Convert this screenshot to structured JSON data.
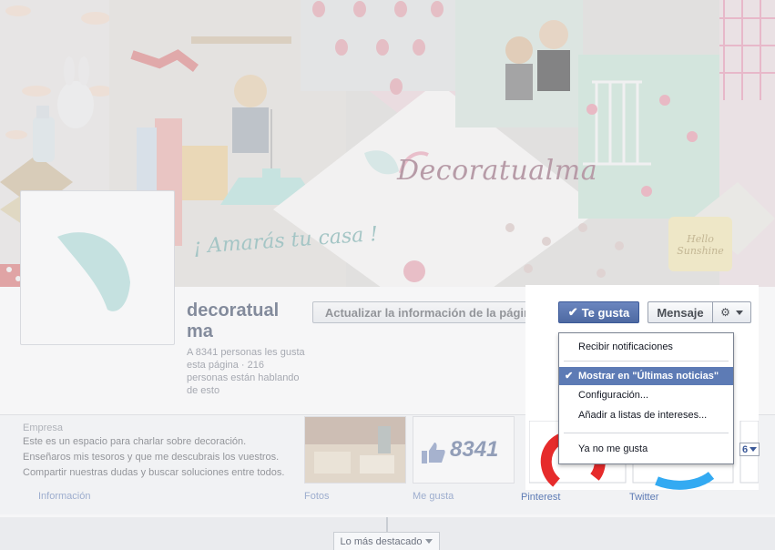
{
  "cover": {
    "brand_text": "Decoratualma",
    "tagline": "¡ Amarás tu casa !",
    "sign_text": "Hello Sunshine"
  },
  "page": {
    "name_line1": "decoratual",
    "name_line2": "ma",
    "stats": "A 8341 personas les gusta esta página · 216 personas están hablando de esto"
  },
  "actions": {
    "update_label": "Actualizar la información de la página",
    "like_label": "Te gusta",
    "message_label": "Mensaje"
  },
  "dropdown": {
    "items": [
      {
        "label": "Recibir notificaciones",
        "checked": false
      },
      {
        "label": "Mostrar en \"Últimas noticias\"",
        "checked": true
      },
      {
        "label": "Configuración...",
        "checked": false
      },
      {
        "label": "Añadir a listas de intereses...",
        "checked": false
      },
      {
        "label": "Ya no me gusta",
        "checked": false
      }
    ]
  },
  "about": {
    "category": "Empresa",
    "lines": [
      "Este es un espacio para charlar sobre decoración.",
      "Enseñaros mis tesoros y que me descubrais los vuestros.",
      "Compartir nuestras dudas y buscar soluciones entre todos."
    ],
    "info_label": "Información"
  },
  "apps": {
    "photos_label": "Fotos",
    "likes_label": "Me gusta",
    "likes_count": "8341",
    "pinterest_label": "Pinterest",
    "twitter_label": "Twitter",
    "more_count": "6"
  },
  "timeline": {
    "highlights_label": "Lo más destacado"
  },
  "colors": {
    "facebook_blue": "#3b5998",
    "menu_highlight": "#5d7bb5",
    "brand_mint": "#a6d9d5"
  }
}
